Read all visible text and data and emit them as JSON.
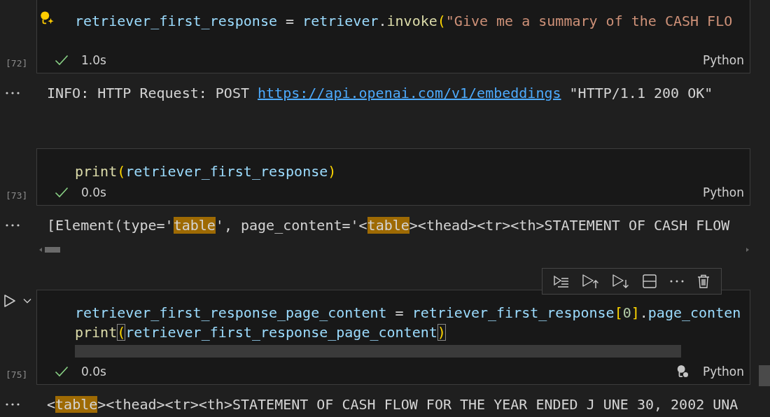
{
  "cells": [
    {
      "count": "[72]",
      "focused": false,
      "succeeded": true,
      "time": "1.0s",
      "language": "Python",
      "sparkle_bulb": true,
      "status_bulb": false,
      "lines": [
        [
          {
            "t": "retriever_first_response",
            "kind": "var",
            "matched": false
          },
          {
            "t": " = ",
            "kind": "op",
            "matched": false
          },
          {
            "t": "retriever",
            "kind": "var",
            "matched": false
          },
          {
            "t": ".",
            "kind": "op",
            "matched": false
          },
          {
            "t": "invoke",
            "kind": "func",
            "matched": false
          },
          {
            "t": "(",
            "kind": "bracket",
            "matched": false
          },
          {
            "t": "\"Give me a summary of the CASH FLO",
            "kind": "str",
            "matched": false
          }
        ]
      ],
      "output": {
        "scrollbar": false,
        "segments": [
          {
            "t": "INFO: HTTP Request: POST ",
            "kind": "text"
          },
          {
            "t": "https://api.openai.com/v1/embeddings",
            "kind": "link"
          },
          {
            "t": " \"HTTP/1.1 200 OK\"",
            "kind": "text"
          }
        ]
      }
    },
    {
      "count": "[73]",
      "focused": false,
      "succeeded": true,
      "time": "0.0s",
      "language": "Python",
      "sparkle_bulb": false,
      "status_bulb": false,
      "lines": [
        [
          {
            "t": "print",
            "kind": "func",
            "matched": false
          },
          {
            "t": "(",
            "kind": "bracket",
            "matched": false
          },
          {
            "t": "retriever_first_response",
            "kind": "var",
            "matched": false
          },
          {
            "t": ")",
            "kind": "bracket",
            "matched": false
          }
        ]
      ],
      "output": {
        "scrollbar": true,
        "segments": [
          {
            "t": "[Element(type='",
            "kind": "text"
          },
          {
            "t": "table",
            "kind": "match"
          },
          {
            "t": "', page_content='<",
            "kind": "text"
          },
          {
            "t": "table",
            "kind": "match"
          },
          {
            "t": "><thead><tr><th>STATEMENT OF CASH FLOW",
            "kind": "text"
          }
        ]
      }
    },
    {
      "count": "[75]",
      "focused": true,
      "succeeded": true,
      "time": "0.0s",
      "language": "Python",
      "sparkle_bulb": false,
      "status_bulb": true,
      "lines": [
        [
          {
            "t": "retriever_first_response_page_content",
            "kind": "var",
            "matched": false
          },
          {
            "t": " = ",
            "kind": "op",
            "matched": false
          },
          {
            "t": "retriever_first_response",
            "kind": "var",
            "matched": false
          },
          {
            "t": "[",
            "kind": "bracket",
            "matched": false
          },
          {
            "t": "0",
            "kind": "num",
            "matched": false
          },
          {
            "t": "]",
            "kind": "bracket",
            "matched": false
          },
          {
            "t": ".",
            "kind": "op",
            "matched": false
          },
          {
            "t": "page_conten",
            "kind": "var",
            "matched": false
          }
        ],
        [
          {
            "t": "print",
            "kind": "func",
            "matched": false
          },
          {
            "t": "(",
            "kind": "bracket",
            "matched": true
          },
          {
            "t": "retriever_first_response_page_content",
            "kind": "var",
            "matched": false
          },
          {
            "t": ")",
            "kind": "bracket",
            "matched": true
          }
        ]
      ],
      "output": {
        "scrollbar": false,
        "segments": [
          {
            "t": "<",
            "kind": "text"
          },
          {
            "t": "table",
            "kind": "match"
          },
          {
            "t": "><thead><tr><th>STATEMENT OF CASH FLOW FOR THE YEAR ENDED J UNE 30, 2002 UNA",
            "kind": "text"
          }
        ]
      }
    }
  ]
}
